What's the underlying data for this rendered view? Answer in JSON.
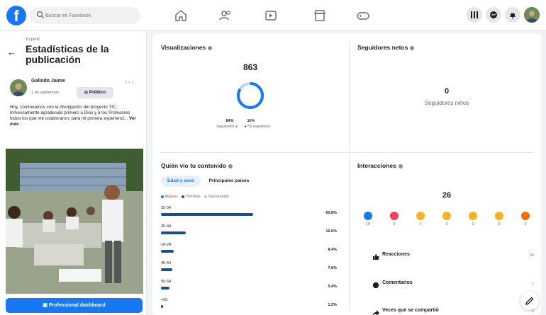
{
  "topbar": {
    "search_placeholder": "Buscar en Facebook",
    "nav_icons": [
      "home-icon",
      "friends-icon",
      "video-icon",
      "marketplace-icon",
      "gaming-icon"
    ],
    "right_icons": [
      "menu-grid-icon",
      "messenger-icon",
      "notifications-icon",
      "profile-avatar"
    ]
  },
  "left": {
    "breadcrumb": "Tu perfil",
    "title": "Estadísticas de la publicación",
    "post": {
      "author": "Galindo Jaime",
      "date": "1 de septiembre",
      "visibility": "Público",
      "text": "Hoy, continuamos con la divulgación del proyecto TIC. Inmensamente agradecido primero a Dios y a los Profesores todos los que me colaboraron, para mi primera experienci...",
      "see_more": "Ver más"
    },
    "dashboard_button": "Professional dashboard"
  },
  "views": {
    "title": "Visualizaciones",
    "total": "863",
    "followers_pct": "84%",
    "followers_label": "Seguidores",
    "non_followers_pct": "16%",
    "non_followers_label": "No seguidores",
    "followers_fraction": 0.84
  },
  "net_followers": {
    "title": "Seguidores netos",
    "value": "0",
    "label": "Seguidores netos"
  },
  "audience": {
    "title": "Quién vio tu contenido",
    "tabs": [
      "Edad y sexo",
      "Principales países"
    ],
    "legend": [
      "Mujeres",
      "Hombres",
      "Desconocido"
    ],
    "age_groups": [
      {
        "range": "25-34",
        "pct": "60.8%",
        "value": 60.8
      },
      {
        "range": "35-44",
        "pct": "16.6%",
        "value": 16.6
      },
      {
        "range": "18-24",
        "pct": "8.4%",
        "value": 8.4
      },
      {
        "range": "45-54",
        "pct": "7.6%",
        "value": 7.6
      },
      {
        "range": "55-64",
        "pct": "5.4%",
        "value": 5.4
      },
      {
        "range": "+65",
        "pct": "1.2%",
        "value": 1.2
      }
    ]
  },
  "interactions": {
    "title": "Interacciones",
    "total": "26",
    "reactions": [
      {
        "icon": "like-icon",
        "count": "18",
        "color": "#1877f2"
      },
      {
        "icon": "love-icon",
        "count": "5",
        "color": "#f33e58"
      },
      {
        "icon": "care-icon",
        "count": "0",
        "color": "#f7b125"
      },
      {
        "icon": "haha-icon",
        "count": "0",
        "color": "#f7b125"
      },
      {
        "icon": "wow-icon",
        "count": "0",
        "color": "#f7b125"
      },
      {
        "icon": "sad-icon",
        "count": "0",
        "color": "#f7b125"
      },
      {
        "icon": "angry-icon",
        "count": "0",
        "color": "#e9710f"
      }
    ],
    "rows": [
      {
        "label": "Reacciones",
        "value": "24"
      },
      {
        "label": "Comentarios",
        "value": "1"
      },
      {
        "label": "Veces que se compartió",
        "value": "1"
      }
    ]
  }
}
